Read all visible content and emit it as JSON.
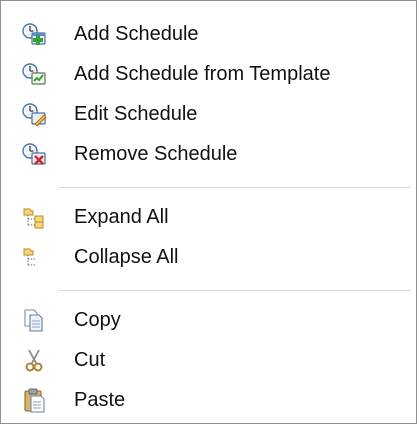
{
  "menu": {
    "items": [
      {
        "label": "Add Schedule",
        "icon": "add-schedule-icon"
      },
      {
        "label": "Add Schedule from Template",
        "icon": "add-schedule-template-icon"
      },
      {
        "label": "Edit Schedule",
        "icon": "edit-schedule-icon"
      },
      {
        "label": "Remove Schedule",
        "icon": "remove-schedule-icon"
      },
      {
        "label": "Expand All",
        "icon": "expand-all-icon"
      },
      {
        "label": "Collapse All",
        "icon": "collapse-all-icon"
      },
      {
        "label": "Copy",
        "icon": "copy-icon"
      },
      {
        "label": "Cut",
        "icon": "cut-icon"
      },
      {
        "label": "Paste",
        "icon": "paste-icon"
      }
    ]
  },
  "colors": {
    "border": "#8e8f8f",
    "separator": "#d6d6d6",
    "text": "#111111",
    "background": "#ffffff"
  }
}
